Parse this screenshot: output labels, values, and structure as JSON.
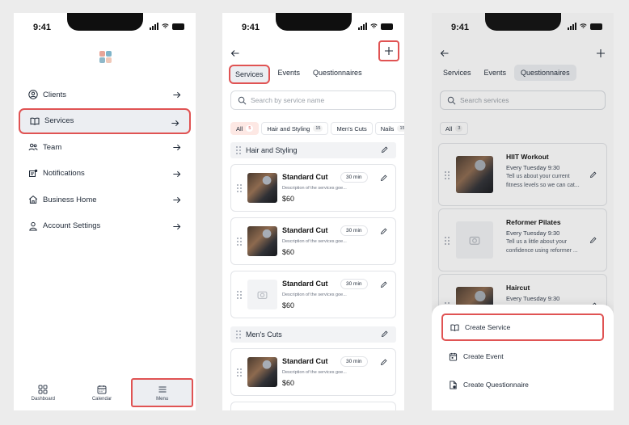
{
  "status": {
    "time": "9:41"
  },
  "screen1": {
    "logo_colors": [
      "#e8a598",
      "#7fb4c9",
      "#8fb8c9",
      "#f0c8b8"
    ],
    "menu": [
      {
        "label": "Clients",
        "icon": "user-circle-icon"
      },
      {
        "label": "Services",
        "icon": "book-open-icon"
      },
      {
        "label": "Team",
        "icon": "team-icon"
      },
      {
        "label": "Notifications",
        "icon": "notifications-icon"
      },
      {
        "label": "Business Home",
        "icon": "home-icon"
      },
      {
        "label": "Account Settings",
        "icon": "user-icon"
      }
    ],
    "tabs": [
      {
        "label": "Dashboard",
        "icon": "grid-icon"
      },
      {
        "label": "Calendar",
        "icon": "calendar-icon"
      },
      {
        "label": "Menu",
        "icon": "hamburger-icon"
      }
    ]
  },
  "screen2": {
    "segments": [
      "Services",
      "Events",
      "Questionnaires"
    ],
    "search_placeholder": "Search by service name",
    "chips": [
      {
        "label": "All",
        "count": "5"
      },
      {
        "label": "Hair and Styling",
        "count": "15"
      },
      {
        "label": "Men's Cuts",
        "count": ""
      },
      {
        "label": "Nails",
        "count": "15"
      }
    ],
    "groups": [
      {
        "name": "Hair and Styling",
        "cards": [
          {
            "title": "Standard Cut",
            "duration": "30 min",
            "desc": "Description of the services goe...",
            "price": "$60",
            "has_photo": true
          },
          {
            "title": "Standard Cut",
            "duration": "30 min",
            "desc": "Description of the services goe...",
            "price": "$60",
            "has_photo": true
          },
          {
            "title": "Standard Cut",
            "duration": "30 min",
            "desc": "Description of the services goe...",
            "price": "$60",
            "has_photo": false
          }
        ]
      },
      {
        "name": "Men's Cuts",
        "cards": [
          {
            "title": "Standard Cut",
            "duration": "30 min",
            "desc": "Description of the services goe...",
            "price": "$60",
            "has_photo": true
          }
        ]
      }
    ]
  },
  "screen3": {
    "segments": [
      "Services",
      "Events",
      "Questionnaires"
    ],
    "search_placeholder": "Search services",
    "chip": {
      "label": "All",
      "count": "3"
    },
    "cards": [
      {
        "title": "HIIT Workout",
        "schedule": "Every Tuesday 9:30",
        "desc": "Tell us about your current fitness levels so we can cat...",
        "has_photo": true
      },
      {
        "title": "Reformer Pilates",
        "schedule": "Every Tuesday 9:30",
        "desc": "Tell us a little about your confidence using reformer ...",
        "has_photo": false
      },
      {
        "title": "Haircut",
        "schedule": "Every Tuesday 9:30",
        "desc": "",
        "has_photo": true
      }
    ],
    "sheet": [
      {
        "label": "Create Service",
        "icon": "book-open-icon"
      },
      {
        "label": "Create Event",
        "icon": "calendar-event-icon"
      },
      {
        "label": "Create Questionnaire",
        "icon": "document-icon"
      }
    ]
  },
  "accent_color": "#e05353"
}
